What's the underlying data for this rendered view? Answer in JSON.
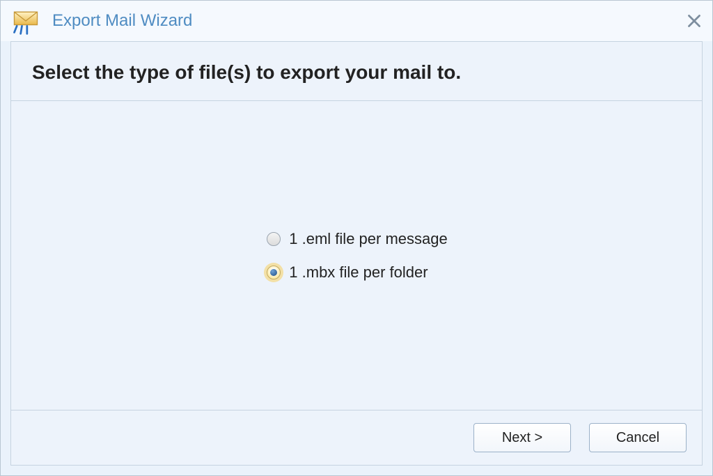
{
  "window": {
    "title": "Export Mail Wizard"
  },
  "heading": "Select the type of file(s) to export your mail to.",
  "options": {
    "eml": {
      "label": "1 .eml file per message",
      "selected": false
    },
    "mbx": {
      "label": "1 .mbx file per folder",
      "selected": true
    }
  },
  "buttons": {
    "next": "Next >",
    "cancel": "Cancel"
  }
}
